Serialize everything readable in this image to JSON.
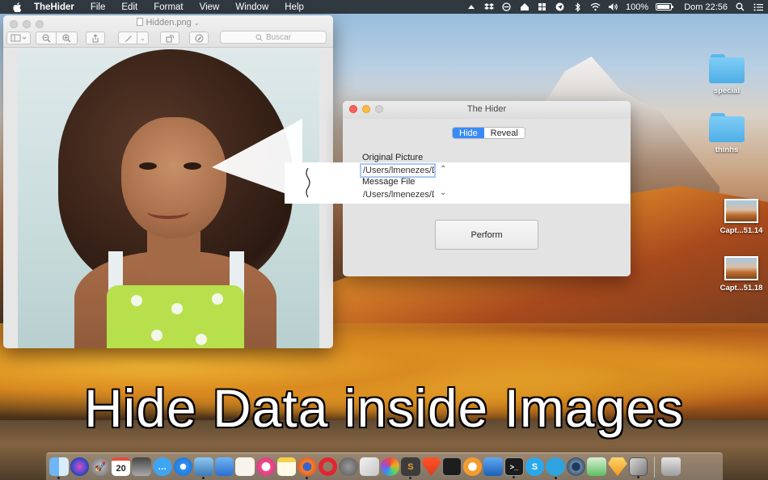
{
  "menubar": {
    "app_name": "TheHider",
    "menus": [
      "File",
      "Edit",
      "Format",
      "View",
      "Window",
      "Help"
    ],
    "battery": "100%",
    "clock": "Dom 22:56"
  },
  "preview": {
    "doc_title": "Hidden.png",
    "search_placeholder": "Buscar"
  },
  "hider": {
    "title": "The Hider",
    "tabs": [
      "Hide",
      "Reveal"
    ],
    "active_tab": "Hide",
    "original_label": "Original Picture",
    "original_path": "/Users/lmenezes/D",
    "message_label": "Message File",
    "message_path": "/Users/lmenezes/D",
    "perform_label": "Perform"
  },
  "desktop_icons": [
    {
      "label": "special",
      "kind": "folder"
    },
    {
      "label": "thinhs",
      "kind": "folder"
    },
    {
      "label": "Capt...51.14",
      "kind": "screenshot"
    },
    {
      "label": "Capt...51.18",
      "kind": "screenshot"
    }
  ],
  "caption": "Hide Data inside Images",
  "dock": {
    "calendar_day": "20",
    "apps": [
      "Finder",
      "Siri",
      "Launchpad",
      "Calendar",
      "Photo Booth",
      "Messages",
      "Safari",
      "Preview",
      "Keynote",
      "TextEdit",
      "iTunes",
      "Notes",
      "Firefox",
      "Opera",
      "System Preferences",
      "Books",
      "Mail",
      "Sublime Text",
      "Brave",
      "Activity Monitor",
      "iBooks",
      "Xcode",
      "Terminal",
      "Skype",
      "Telegram",
      "QuickTime Player",
      "Numbers",
      "Sketch",
      "TheHider",
      "Trash"
    ]
  },
  "colors": {
    "accent": "#3a8bf7",
    "close": "#fc605c",
    "minimize": "#fdbc40"
  }
}
